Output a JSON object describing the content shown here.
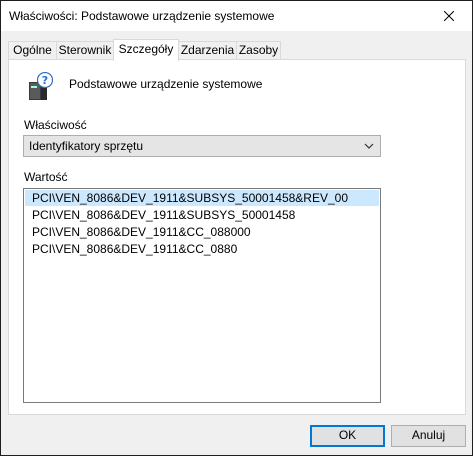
{
  "window": {
    "title": "Właściwości: Podstawowe urządzenie systemowe"
  },
  "tabs": [
    {
      "label": "Ogólne",
      "active": false
    },
    {
      "label": "Sterownik",
      "active": false
    },
    {
      "label": "Szczegóły",
      "active": true
    },
    {
      "label": "Zdarzenia",
      "active": false
    },
    {
      "label": "Zasoby",
      "active": false
    }
  ],
  "device": {
    "name": "Podstawowe urządzenie systemowe",
    "icon": "unknown-device-icon"
  },
  "property": {
    "label": "Właściwość",
    "selected": "Identyfikatory sprzętu"
  },
  "value": {
    "label": "Wartość",
    "items": [
      "PCI\\VEN_8086&DEV_1911&SUBSYS_50001458&REV_00",
      "PCI\\VEN_8086&DEV_1911&SUBSYS_50001458",
      "PCI\\VEN_8086&DEV_1911&CC_088000",
      "PCI\\VEN_8086&DEV_1911&CC_0880"
    ],
    "selected_index": 0
  },
  "buttons": {
    "ok": "OK",
    "cancel": "Anuluj"
  },
  "colors": {
    "selection": "#cce8ff",
    "default_button_border": "#0078d7"
  }
}
